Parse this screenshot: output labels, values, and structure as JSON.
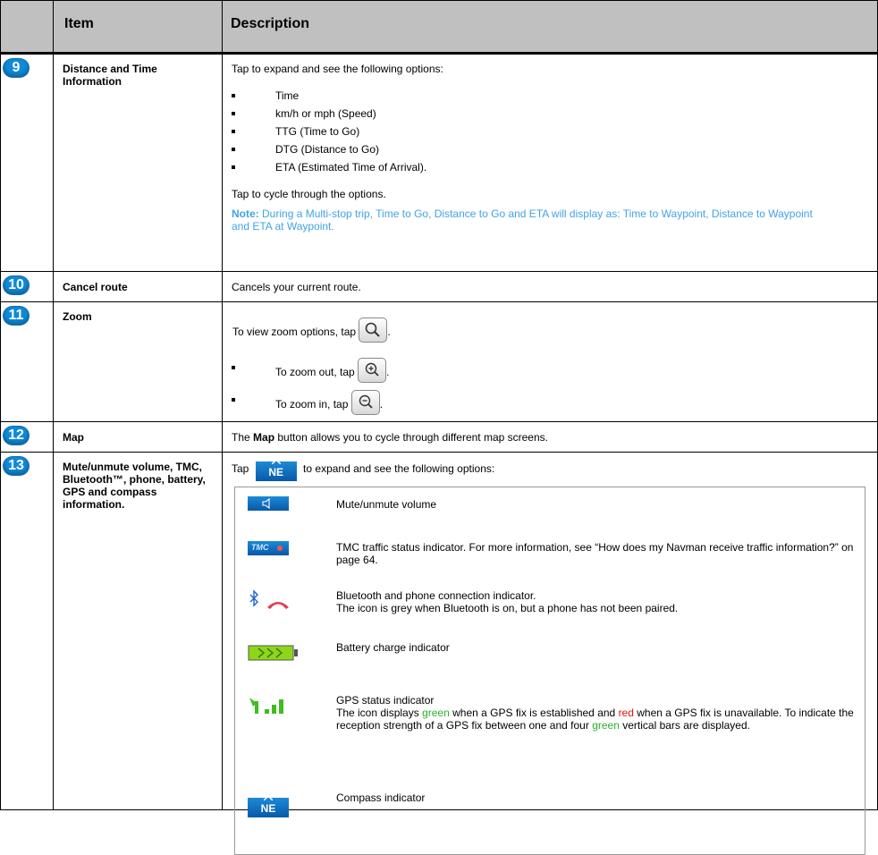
{
  "header": {
    "item": "Item",
    "description": "Description"
  },
  "rows": [
    {
      "number": "9",
      "item": "Distance and Time Information",
      "intro": "Tap to expand and see the following options:",
      "bullets": [
        "Time",
        "km/h or mph (Speed)",
        "TTG (Time to Go)",
        "DTG (Distance to Go)",
        "ETA (Estimated Time of Arrival)."
      ],
      "cycle": "Tap to cycle through the options.",
      "note_label": "Note:",
      "note_text": "During a Multi-stop trip, Time to Go, Distance to Go and ETA will display as: Time to Waypoint, Distance to Waypoint and ETA at Waypoint."
    },
    {
      "number": "10",
      "item": "Cancel route",
      "desc": "Cancels your current route."
    },
    {
      "number": "11",
      "item": "Zoom",
      "view": "To view zoom options, tap",
      "zoom_out": "To zoom out, tap",
      "zoom_in": "To zoom in, tap",
      "period": "."
    },
    {
      "number": "12",
      "item": "Map",
      "desc_pre": "The",
      "desc_bold": "Map",
      "desc_post": "button allows you to cycle through different map screens."
    },
    {
      "number": "13",
      "item": "Mute/unmute volume, TMC, Bluetooth™, phone, battery, GPS and compass information.",
      "tap": "Tap",
      "tap_after": "to expand and see the following options:",
      "compass_label": "NE",
      "options": {
        "mute": "Mute/unmute volume",
        "tmc": "TMC traffic status indicator. For more information, see “How does my Navman receive traffic information?” on page 64.",
        "tmc_icon_text": "TMC",
        "bt_1": "Bluetooth and phone connection indicator.",
        "bt_2": "The icon is grey when Bluetooth is on, but a phone has not been paired.",
        "battery": "Battery charge indicator",
        "gps_title": "GPS status indicator",
        "gps_a": "The icon displays",
        "gps_green1": "green",
        "gps_b": "when a GPS fix is established and",
        "gps_red": "red",
        "gps_c": "when a GPS fix is unavailable. To indicate the reception strength of a GPS fix between one and four",
        "gps_green2": "green",
        "gps_d": "vertical bars are displayed.",
        "compass": "Compass indicator"
      }
    }
  ],
  "colors": {
    "badge": "#0e8ad8",
    "note": "#3fa3e6",
    "header_bg": "#c0c0c0",
    "green": "#2bb02b",
    "red": "#e01010"
  }
}
